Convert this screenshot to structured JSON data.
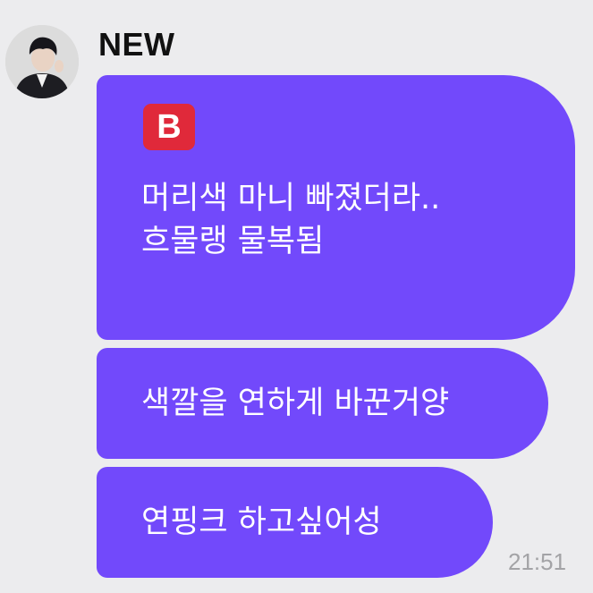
{
  "chat": {
    "sender_name": "NEW",
    "avatar_icon": "profile-photo-icon",
    "accent_color": "#7249fb",
    "badge_color": "#e0293a",
    "messages": [
      {
        "badge": "B",
        "lines": [
          "머리색 마니 빠졌더라..",
          "흐물랭 물복됨"
        ]
      },
      {
        "lines": [
          "색깔을 연하게 바꾼거양"
        ]
      },
      {
        "lines": [
          "연핑크 하고싶어성"
        ]
      }
    ],
    "timestamp": "21:51"
  }
}
